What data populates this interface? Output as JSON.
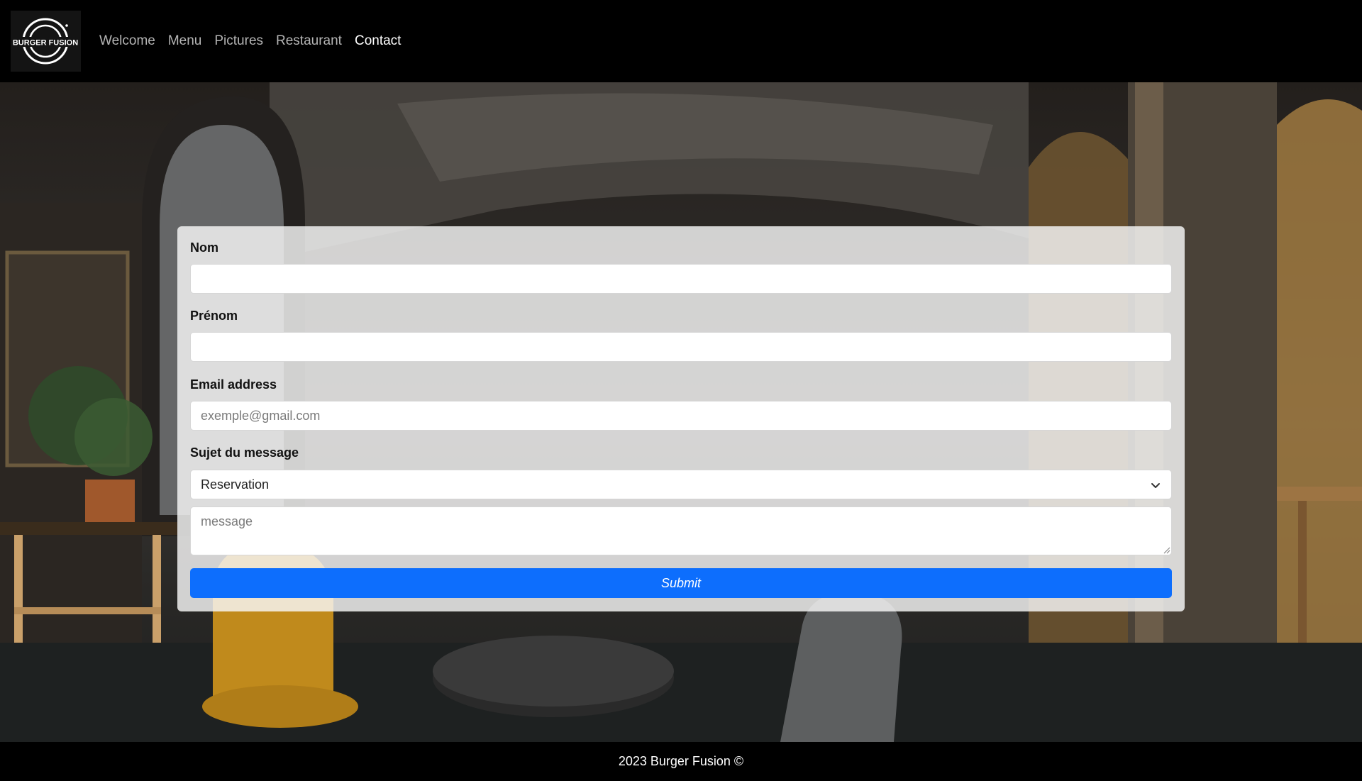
{
  "nav": {
    "logo_text": "BURGER FUSION",
    "links": [
      {
        "label": "Welcome"
      },
      {
        "label": "Menu"
      },
      {
        "label": "Pictures"
      },
      {
        "label": "Restaurant"
      },
      {
        "label": "Contact",
        "active": true
      }
    ]
  },
  "form": {
    "nom_label": "Nom",
    "nom_value": "",
    "prenom_label": "Prénom",
    "prenom_value": "",
    "email_label": "Email address",
    "email_placeholder": "exemple@gmail.com",
    "subject_label": "Sujet du message",
    "subject_selected": "Reservation",
    "message_placeholder": "message",
    "submit_label": "Submit"
  },
  "footer": {
    "text": "2023 Burger Fusion ©"
  },
  "icons": {
    "dropdown": "chevron-down-icon",
    "resize": "resize-grip-icon"
  },
  "colors": {
    "navbar": "#000000",
    "primary": "#0d6efd",
    "card": "#f8f8f8",
    "footer": "#000000"
  }
}
